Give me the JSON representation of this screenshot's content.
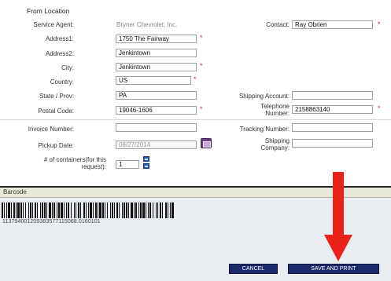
{
  "section": {
    "title": "From Location"
  },
  "fields": {
    "service_agent": {
      "label": "Service Agent:",
      "value": "Bryner Chevrolet, Inc."
    },
    "contact": {
      "label": "Contact:",
      "value": "Ray Obrien"
    },
    "address1": {
      "label": "Address1:",
      "value": "1750 The Fairway"
    },
    "address2": {
      "label": "Address2:",
      "value": "Jenkintown"
    },
    "city": {
      "label": "City:",
      "value": "Jenkintown"
    },
    "country": {
      "label": "Country:",
      "value": "US"
    },
    "state": {
      "label": "State / Prov:",
      "value": "PA"
    },
    "shipping_account": {
      "label": "Shipping Account:",
      "value": ""
    },
    "postal_code": {
      "label": "Postal Code:",
      "value": "19046-1606"
    },
    "telephone": {
      "label_line1": "Telephone",
      "label_line2": "Number:",
      "value": "2158863140"
    },
    "invoice_number": {
      "label": "Invoice Number:",
      "value": ""
    },
    "tracking_number": {
      "label": "Tracking Number:",
      "value": ""
    },
    "pickup_date": {
      "label": "Pickup Date:",
      "value": "08/27/2014"
    },
    "shipping_company": {
      "label_line1": "Shipping",
      "label_line2": "Company:",
      "value": ""
    },
    "containers": {
      "label_line1": "# of containers(for this",
      "label_line2": "request):",
      "value": "1"
    }
  },
  "required_marker": "*",
  "barcode": {
    "label": "Barcode",
    "number": "113794001209383577115068.0160101"
  },
  "buttons": {
    "cancel": "CANCEL",
    "save_print": "SAVE AND PRINT"
  },
  "colors": {
    "required": "#e32b2b",
    "button": "#1b2a6b",
    "arrow": "#e8231b",
    "calendar": "#6a3f86"
  },
  "icons": {
    "calendar": "calendar-icon",
    "spinner": "spinner-icon",
    "arrow": "down-arrow-annotation"
  }
}
